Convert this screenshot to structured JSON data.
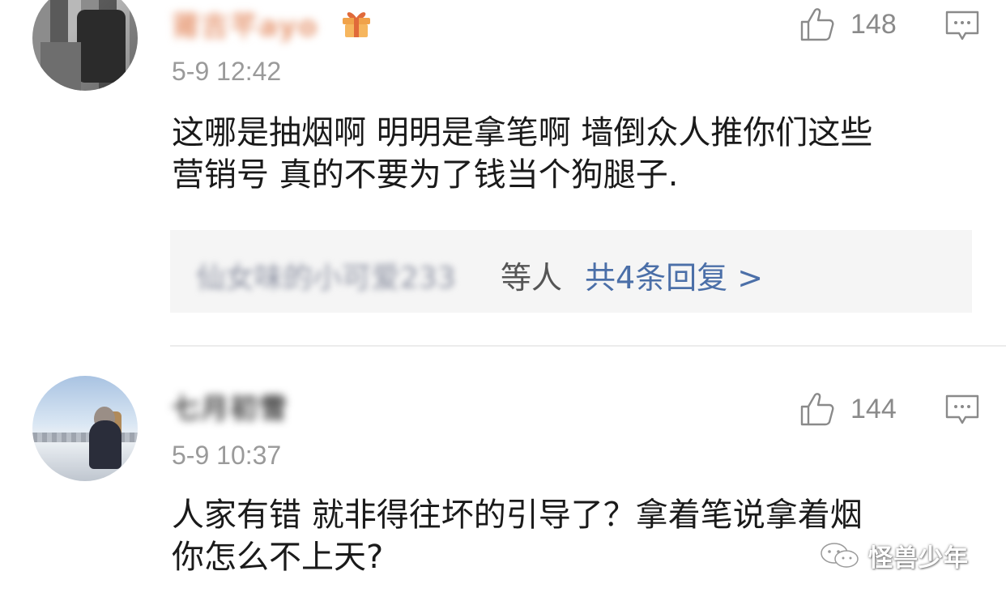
{
  "comments": [
    {
      "username": "莆吉芊ayo",
      "timestamp": "5-9 12:42",
      "likes": "148",
      "body_lines": [
        "这哪是抽烟啊 明明是拿笔啊 墙倒众人推你们这些",
        "营销号 真的不要为了钱当个狗腿子."
      ],
      "replies": {
        "replier": "仙女味的小可爱233",
        "etc_label": "等人",
        "count_label": "共4条回复 >"
      }
    },
    {
      "username": "七月初雪",
      "timestamp": "5-9 10:37",
      "likes": "144",
      "body_lines": [
        "人家有错 就非得往坏的引导了？拿着笔说拿着烟",
        "你怎么不上天?"
      ]
    }
  ],
  "watermark": {
    "text": "怪兽少年",
    "icon": "wechat-icon"
  },
  "colors": {
    "vip_username": "#e79b77",
    "link_blue": "#4b6fa8",
    "meta_gray": "#9a9a9a"
  }
}
